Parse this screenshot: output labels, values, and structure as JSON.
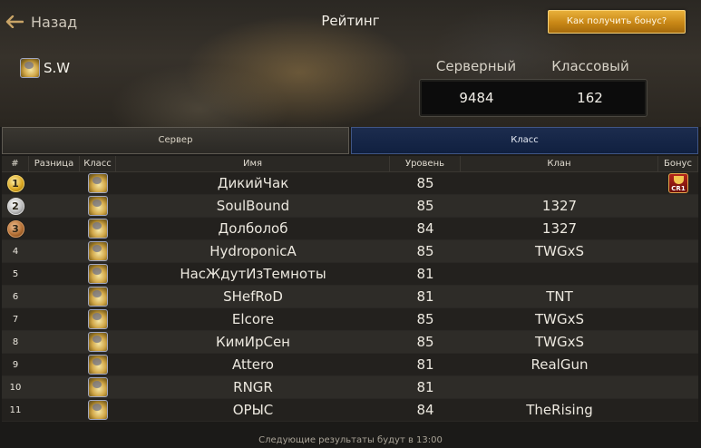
{
  "header": {
    "back_label": "Назад",
    "title": "Рейтинг",
    "bonus_button": "Как получить бонус?"
  },
  "player": {
    "name": "S.W",
    "icon": "class-icon"
  },
  "scores": {
    "server_label": "Серверный",
    "class_label": "Классовый",
    "server_value": "9484",
    "class_value": "162"
  },
  "tabs": [
    {
      "label": "Сервер",
      "active": false
    },
    {
      "label": "Класс",
      "active": true
    }
  ],
  "table": {
    "columns": [
      "#",
      "Разница",
      "Класс",
      "Имя",
      "Уровень",
      "Клан",
      "Бонус"
    ],
    "rows": [
      {
        "rank": "1",
        "medal": "gold",
        "diff": "",
        "name": "ДикийЧак",
        "level": "85",
        "clan": "",
        "bonus": "CR1"
      },
      {
        "rank": "2",
        "medal": "silver",
        "diff": "",
        "name": "SoulBound",
        "level": "85",
        "clan": "1327",
        "bonus": ""
      },
      {
        "rank": "3",
        "medal": "bronze",
        "diff": "",
        "name": "Долболоб",
        "level": "84",
        "clan": "1327",
        "bonus": ""
      },
      {
        "rank": "4",
        "medal": "",
        "diff": "",
        "name": "HydroponicA",
        "level": "85",
        "clan": "TWGxS",
        "bonus": ""
      },
      {
        "rank": "5",
        "medal": "",
        "diff": "",
        "name": "НасЖдутИзТемноты",
        "level": "81",
        "clan": "",
        "bonus": ""
      },
      {
        "rank": "6",
        "medal": "",
        "diff": "",
        "name": "SHefRoD",
        "level": "81",
        "clan": "TNT",
        "bonus": ""
      },
      {
        "rank": "7",
        "medal": "",
        "diff": "",
        "name": "Elcore",
        "level": "85",
        "clan": "TWGxS",
        "bonus": ""
      },
      {
        "rank": "8",
        "medal": "",
        "diff": "",
        "name": "КимИрСен",
        "level": "85",
        "clan": "TWGxS",
        "bonus": ""
      },
      {
        "rank": "9",
        "medal": "",
        "diff": "",
        "name": "Attero",
        "level": "81",
        "clan": "RealGun",
        "bonus": ""
      },
      {
        "rank": "10",
        "medal": "",
        "diff": "",
        "name": "RNGR",
        "level": "81",
        "clan": "",
        "bonus": ""
      },
      {
        "rank": "11",
        "medal": "",
        "diff": "",
        "name": "ОРЫС",
        "level": "84",
        "clan": "TheRising",
        "bonus": ""
      }
    ]
  },
  "footer": {
    "text": "Следующие результаты будут в 13:00"
  },
  "colors": {
    "bonus_button": "#c88716",
    "active_tab": "#102040",
    "background": "#1b1a18"
  }
}
